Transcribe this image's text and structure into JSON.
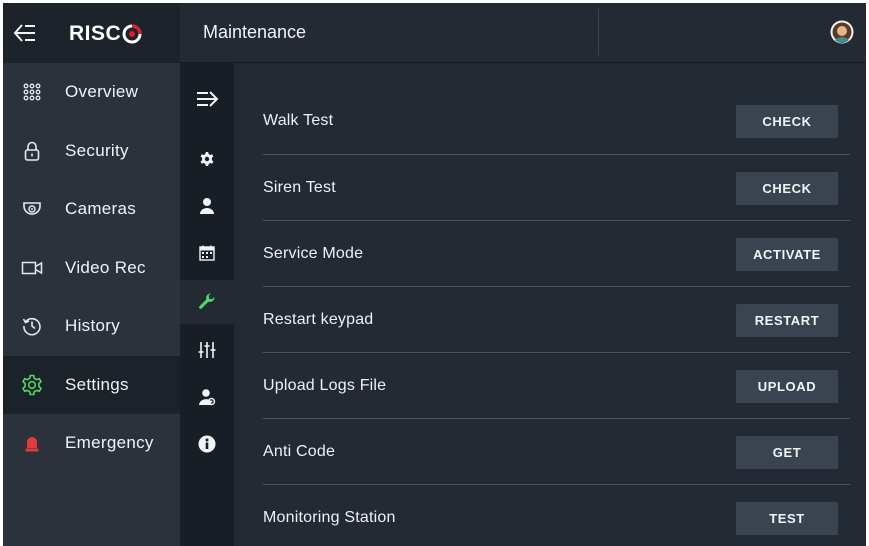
{
  "brand": {
    "logo_text": "RISC"
  },
  "header": {
    "title": "Maintenance"
  },
  "colors": {
    "accent": "#4cd964",
    "emergency": "#e23b3b",
    "logo_red": "#e31b23"
  },
  "sidebar": {
    "items": [
      {
        "label": "Overview",
        "icon": "grid-icon"
      },
      {
        "label": "Security",
        "icon": "lock-icon"
      },
      {
        "label": "Cameras",
        "icon": "camera-icon"
      },
      {
        "label": "Video Rec",
        "icon": "video-icon"
      },
      {
        "label": "History",
        "icon": "history-icon"
      },
      {
        "label": "Settings",
        "icon": "gear-icon",
        "active": true
      },
      {
        "label": "Emergency",
        "icon": "siren-icon"
      }
    ]
  },
  "subrail": {
    "items": [
      {
        "icon": "expand-icon"
      },
      {
        "icon": "gear-icon"
      },
      {
        "icon": "user-icon"
      },
      {
        "icon": "calendar-icon"
      },
      {
        "icon": "wrench-icon",
        "active": true
      },
      {
        "icon": "sliders-icon"
      },
      {
        "icon": "users-icon"
      },
      {
        "icon": "info-icon"
      }
    ]
  },
  "maintenance": {
    "rows": [
      {
        "label": "Walk Test",
        "button": "CHECK"
      },
      {
        "label": "Siren Test",
        "button": "CHECK"
      },
      {
        "label": "Service Mode",
        "button": "ACTIVATE"
      },
      {
        "label": "Restart keypad",
        "button": "RESTART"
      },
      {
        "label": "Upload Logs File",
        "button": "UPLOAD"
      },
      {
        "label": "Anti Code",
        "button": "GET"
      },
      {
        "label": "Monitoring Station",
        "button": "TEST"
      }
    ]
  }
}
